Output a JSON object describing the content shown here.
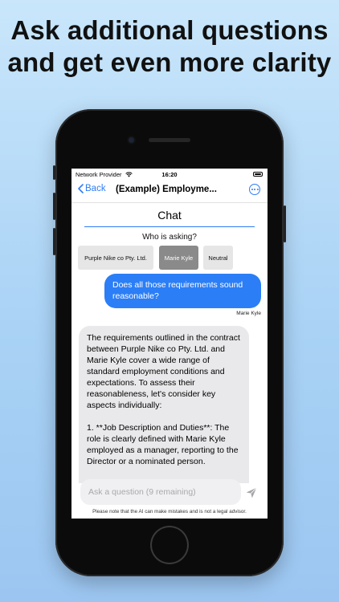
{
  "headline": {
    "line1": "Ask additional questions",
    "line2": "and get even more clarity"
  },
  "status_bar": {
    "carrier": "Network Provider",
    "time": "16:20"
  },
  "nav": {
    "back_label": "Back",
    "title": "(Example) Employme..."
  },
  "chat": {
    "title": "Chat",
    "who_asking": "Who is asking?",
    "options": [
      "Purple Nike co Pty. Ltd.",
      "Marie Kyle",
      "Neutral"
    ],
    "selected_option": "Marie Kyle"
  },
  "messages": {
    "user_message": "Does all those requirements sound reasonable?",
    "user_name": "Marie Kyle",
    "ai_response": "The requirements outlined in the contract between Purple Nike co Pty. Ltd. and Marie Kyle cover a wide range of standard employment conditions and expectations. To assess their reasonableness, let's consider key aspects individually:\n\n1. **Job Description and Duties**: The role is clearly defined with Marie Kyle employed as a manager, reporting to the Director or a nominated person."
  },
  "composer": {
    "placeholder": "Ask a question (9 remaining)",
    "value": ""
  },
  "disclaimer": "Please note that the AI can make mistakes and is not a legal advisor.",
  "colors": {
    "accent": "#2f7cf6",
    "user_bubble": "#2b7ef6",
    "ai_bubble": "#e9e9eb",
    "chip_selected": "#8a8a8a"
  }
}
